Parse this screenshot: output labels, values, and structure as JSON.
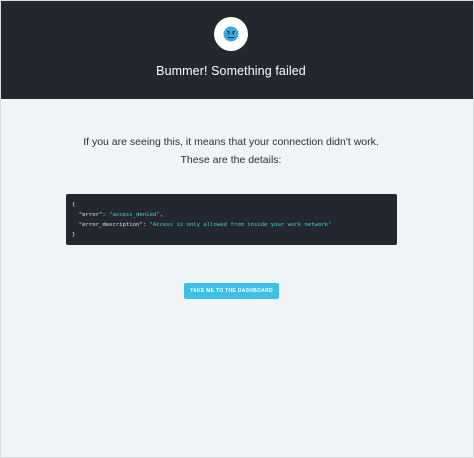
{
  "header": {
    "title": "Bummer! Something failed",
    "icon": "worried-face-icon",
    "background_color": "#23272f",
    "emoji_color": "#3aa8dc"
  },
  "message": {
    "line1": "If you are seeing this, it means that your connection didn't work.",
    "line2": "These are the details:"
  },
  "details": {
    "open_brace": "{",
    "error_key": "\"error\"",
    "error_value": "\"access_denied\"",
    "description_key": "\"error_description\"",
    "description_value": "\"Access is only allowed from inside your work network\"",
    "close_brace": "}"
  },
  "actions": {
    "dashboard_button": "TAKE ME TO THE DASHBOARD",
    "button_color": "#3dbfe8"
  }
}
